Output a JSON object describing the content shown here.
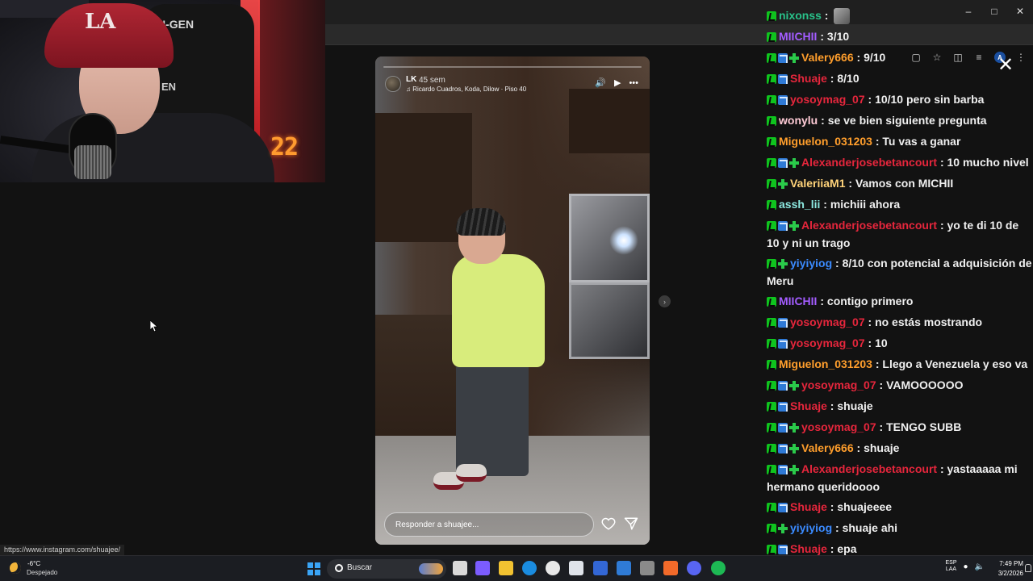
{
  "story": {
    "username": "LK",
    "time_ago": "45 sem",
    "music": "Ricardo Cuadros, Koda, Dilow · Piso 40",
    "reply_placeholder": "Responder a shuajee..."
  },
  "webcam": {
    "chair_brand_top": "N-GEN",
    "chair_brand_mid": "EN",
    "cap_logo": "LA",
    "clock_display": "22"
  },
  "status_url": "https://www.instagram.com/shuajee/",
  "chat": [
    {
      "user": "nixonss",
      "color": "#29c28a",
      "badges": [
        "mod"
      ],
      "text": "",
      "emote": true
    },
    {
      "user": "MIICHII",
      "color": "#a35cff",
      "badges": [
        "mod"
      ],
      "text": "3/10"
    },
    {
      "user": "Valery666",
      "color": "#ff9e2c",
      "badges": [
        "mod",
        "sub",
        "gift"
      ],
      "text": "9/10"
    },
    {
      "user": "Shuaje",
      "color": "#e6263c",
      "badges": [
        "mod",
        "sub"
      ],
      "text": "8/10"
    },
    {
      "user": "yosoymag_07",
      "color": "#e6263c",
      "badges": [
        "mod",
        "sub"
      ],
      "text": "10/10 pero sin barba"
    },
    {
      "user": "wonylu",
      "color": "#ffcbd6",
      "badges": [
        "mod"
      ],
      "text": "se ve bien siguiente pregunta"
    },
    {
      "user": "Miguelon_031203",
      "color": "#ff9e2c",
      "badges": [
        "mod"
      ],
      "text": "Tu vas a ganar"
    },
    {
      "user": "Alexanderjosebetancourt",
      "color": "#e6263c",
      "badges": [
        "mod",
        "sub",
        "gift"
      ],
      "text": "10 mucho nivel"
    },
    {
      "user": "ValeriiaM1",
      "color": "#ffd37a",
      "badges": [
        "mod",
        "gift"
      ],
      "text": "Vamos con MICHII"
    },
    {
      "user": "assh_lii",
      "color": "#8ce8e0",
      "badges": [
        "mod"
      ],
      "text": "michiii ahora"
    },
    {
      "user": "Alexanderjosebetancourt",
      "color": "#e6263c",
      "badges": [
        "mod",
        "sub",
        "gift"
      ],
      "text": "yo te di 10 de 10 y ni un trago"
    },
    {
      "user": "yiyiyiog",
      "color": "#3b8bff",
      "badges": [
        "mod",
        "gift"
      ],
      "text": "8/10 con potencial a adquisición de Meru"
    },
    {
      "user": "MIICHII",
      "color": "#a35cff",
      "badges": [
        "mod"
      ],
      "text": "contigo primero"
    },
    {
      "user": "yosoymag_07",
      "color": "#e6263c",
      "badges": [
        "mod",
        "sub"
      ],
      "text": "no estás mostrando"
    },
    {
      "user": "yosoymag_07",
      "color": "#e6263c",
      "badges": [
        "mod",
        "sub"
      ],
      "text": "10"
    },
    {
      "user": "Miguelon_031203",
      "color": "#ff9e2c",
      "badges": [
        "mod"
      ],
      "text": "Llego a Venezuela y eso va"
    },
    {
      "user": "yosoymag_07",
      "color": "#e6263c",
      "badges": [
        "mod",
        "sub",
        "gift"
      ],
      "text": "VAMOOOOOO"
    },
    {
      "user": "Shuaje",
      "color": "#e6263c",
      "badges": [
        "mod",
        "sub"
      ],
      "text": "shuaje"
    },
    {
      "user": "yosoymag_07",
      "color": "#e6263c",
      "badges": [
        "mod",
        "sub",
        "gift"
      ],
      "text": "TENGO SUBB"
    },
    {
      "user": "Valery666",
      "color": "#ff9e2c",
      "badges": [
        "mod",
        "sub",
        "gift"
      ],
      "text": "shuaje"
    },
    {
      "user": "Alexanderjosebetancourt",
      "color": "#e6263c",
      "badges": [
        "mod",
        "sub",
        "gift"
      ],
      "text": "yastaaaaa mi hermano queridoooo"
    },
    {
      "user": "Shuaje",
      "color": "#e6263c",
      "badges": [
        "mod",
        "sub"
      ],
      "text": "shuajeeee"
    },
    {
      "user": "yiyiyiog",
      "color": "#3b8bff",
      "badges": [
        "mod",
        "gift"
      ],
      "text": "shuaje ahi"
    },
    {
      "user": "Shuaje",
      "color": "#e6263c",
      "badges": [
        "mod",
        "sub"
      ],
      "text": "epa"
    },
    {
      "user": "Alexanderjosebetancourt",
      "color": "#e6263c",
      "badges": [
        "mod",
        "sub",
        "gift"
      ],
      "text": "shuaje"
    }
  ],
  "taskbar": {
    "weather_temp": "-6°C",
    "weather_desc": "Despejado",
    "search_label": "Buscar",
    "lang_top": "ESP",
    "lang_bottom": "LAA",
    "time": "7:49 PM",
    "date": "3/2/2026",
    "apps": [
      "file-explorer-icon",
      "copilot-icon",
      "folder-icon",
      "edge-icon",
      "chrome-icon",
      "store-icon",
      "vscode-icon",
      "mail-icon",
      "obs-icon",
      "app-icon",
      "discord-icon",
      "spotify-icon"
    ],
    "app_colors": [
      "#d9d9d9",
      "#7b5cff",
      "#f1c231",
      "#1a8ce0",
      "#e8e8e8",
      "#dfe3ea",
      "#3367d6",
      "#2f7bd6",
      "#8a8a8a",
      "#f26a2a",
      "#5865f2",
      "#1db954"
    ]
  }
}
